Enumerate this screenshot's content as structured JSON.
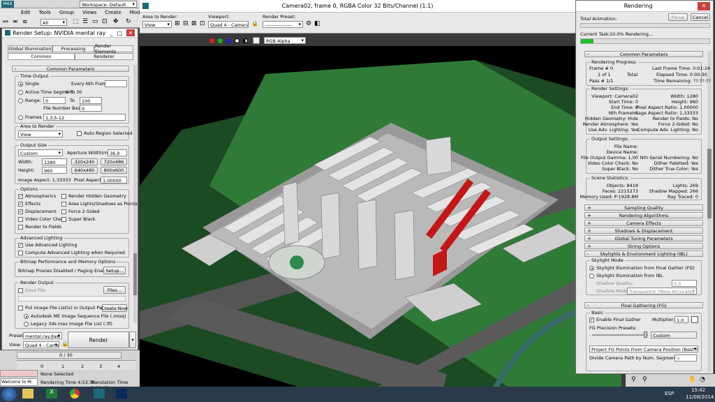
{
  "app": {
    "logo": "MAX",
    "workspace": "Workspace: Default",
    "menu": [
      "Edit",
      "Tools",
      "Group",
      "Views",
      "Create",
      "Modifiers"
    ],
    "selection_filter": "All"
  },
  "render_setup": {
    "title": "Render Setup: NVIDIA mental ray",
    "tabs_row1": [
      "Global Illumination",
      "Processing",
      "Render Elements"
    ],
    "tabs_row2": [
      "Common",
      "Renderer"
    ],
    "section": "Common Parameters",
    "time_output": {
      "label": "Time Output",
      "single": "Single",
      "every_nth": "Every Nth Frame:",
      "every_nth_value": "",
      "active_segment": "Active Time Segment:",
      "active_range": "0 To 30",
      "range": "Range:",
      "range_from": "0",
      "to": "To",
      "range_to": "100",
      "file_number_base": "File Number Base:",
      "file_number_value": "0",
      "frames": "Frames",
      "frames_value": "1,3,5-12"
    },
    "area": {
      "label": "Area to Render",
      "value": "View",
      "auto_region": "Auto Region Selected"
    },
    "output_size": {
      "label": "Output Size",
      "preset": "Custom",
      "aperture_label": "Aperture Width(mm):",
      "aperture_value": "36,0",
      "width_label": "Width:",
      "width": "1280",
      "height_label": "Height:",
      "height": "960",
      "presets": [
        "320x240",
        "720x486",
        "640x480",
        "800x600"
      ],
      "image_aspect": "Image Aspect: 1,33333",
      "pixel_aspect_label": "Pixel Aspect:",
      "pixel_aspect": "1,00000"
    },
    "options": {
      "label": "Options",
      "left": [
        "Atmospherics",
        "Effects",
        "Displacement",
        "Video Color Check",
        "Render to Fields"
      ],
      "left_checked": [
        true,
        true,
        true,
        false,
        false
      ],
      "right": [
        "Render Hidden Geometry",
        "Area Lights/Shadows as Points",
        "Force 2-Sided",
        "Super Black"
      ],
      "right_checked": [
        false,
        false,
        false,
        false
      ]
    },
    "advanced_lighting": {
      "label": "Advanced Lighting",
      "use": "Use Advanced Lighting",
      "compute": "Compute Advanced Lighting when Required"
    },
    "bitmap": {
      "label": "Bitmap Performance and Memory Options",
      "status": "Bitmap Proxies Disabled / Paging Enabled",
      "setup": "Setup..."
    },
    "render_output": {
      "label": "Render Output",
      "save_file": "Save File",
      "files": "Files...",
      "put_image": "Put Image File List(s) in Output Path(s)",
      "create_now": "Create Now",
      "autodesk": "Autodesk ME Image Sequence File (.imsq)",
      "legacy": "Legacy 3ds max Image File List (.ifl)"
    },
    "preset_label": "Preset:",
    "preset_value": "mental.ray.daw",
    "view_label": "View:",
    "view_value": "Quad 4 - Camer",
    "render_btn": "Render"
  },
  "frame_window": {
    "title": "Camera02, frame 0, RGBA Color 32 Bits/Channel (1:1)",
    "area_label": "Area to Render:",
    "area_value": "View",
    "viewport_label": "Viewport:",
    "viewport_value": "Quad 4 - Camera( ▾",
    "preset_label": "Render Preset:",
    "preset_value": "-----------------",
    "channel_value": "RGB Alpha"
  },
  "rendering": {
    "title": "Rendering",
    "total_animation": "Total Animation:",
    "pause": "Pause",
    "cancel": "Cancel",
    "current_task": "Current Task:",
    "task_text": "10.0%  Rendering...",
    "progress": 0.1,
    "common_params": "Common Parameters",
    "progress_group": {
      "label": "Rendering Progress:",
      "frame": "Frame #  0",
      "of": "1 of 1",
      "total": "Total",
      "pass": "Pass #  1/1",
      "last_frame": "Last Frame Time: 0:01:24",
      "elapsed": "Elapsed Time: 0:00:30",
      "remaining": "Time Remaining: ??:??:??"
    },
    "render_settings": {
      "label": "Render Settings:",
      "left": [
        "Viewport: Camera02",
        "Start Time: 0",
        "End Time: 0",
        "Nth Frame: 1",
        "Hidden Geometry: Hide",
        "Render Atmosphere: Yes",
        "Use Adv. Lighting: Yes"
      ],
      "right": [
        "Width: 1280",
        "Height: 960",
        "Pixel Aspect Ratio: 1,00000",
        "Image Aspect Ratio: 1,33333",
        "Render to Fields: No",
        "Force 2-Sided: No",
        "Compute Adv. Lighting: No"
      ]
    },
    "output_settings": {
      "label": "Output Settings:",
      "left": [
        "File Name:",
        "Device Name:",
        "File Output Gamma: 1,00",
        "Video Color Check: No",
        "Super Black: No"
      ],
      "right": [
        "",
        "",
        "Nth Serial Numbering: No",
        "Dither Paletted: Yes",
        "Dither True Color: Yes"
      ]
    },
    "scene_stats": {
      "label": "Scene Statistics:",
      "left": [
        "Objects: 8418",
        "Faces: 2215273",
        "Memory Used: P:1928.8M"
      ],
      "right": [
        "Lights: 269",
        "Shadow Mapped: 266",
        "Ray Traced: 0"
      ]
    },
    "rollouts": [
      "Sampling Quality",
      "Rendering Algorithms",
      "Camera Effects",
      "Shadows & Displacement",
      "Global Tuning Parameters",
      "String Options"
    ],
    "skylights": {
      "label": "Skylights & Environment Lighting (IBL)",
      "mode": "Skylight Mode",
      "fg": "Skylight Illumination from Final Gather (FG)",
      "ibl": "Skylight Illumination from IBL",
      "shadow_quality_label": "Shadow Quality:",
      "shadow_quality": "0,5",
      "shadow_mode_label": "Shadow Mode:",
      "shadow_mode": "Transparent (More Accurate)"
    },
    "fg": {
      "label": "Final Gathering (FG)",
      "basic": "Basic",
      "enable": "Enable Final Gather",
      "multiplier_label": "Multiplier:",
      "multiplier": "1,0",
      "precision_label": "FG Precision Presets:",
      "precision": "Custom",
      "project": "Project FG Points From Camera Position (Best for Stills)",
      "divide": "Divide Camera Path by Num. Segments:",
      "divide_value": "9"
    }
  },
  "status": {
    "selection": "None Selected",
    "rendering_time": "Rendering Time  4:53:30",
    "translation_time": "Translation Time  0:00:45",
    "welcome": "Welcome to M:",
    "timeline": "0 / 30",
    "ticks": [
      "0",
      "1",
      "2",
      "3",
      "4"
    ]
  },
  "taskbar": {
    "lang": "ESP",
    "time": "15:42",
    "date": "11/08/2014"
  }
}
